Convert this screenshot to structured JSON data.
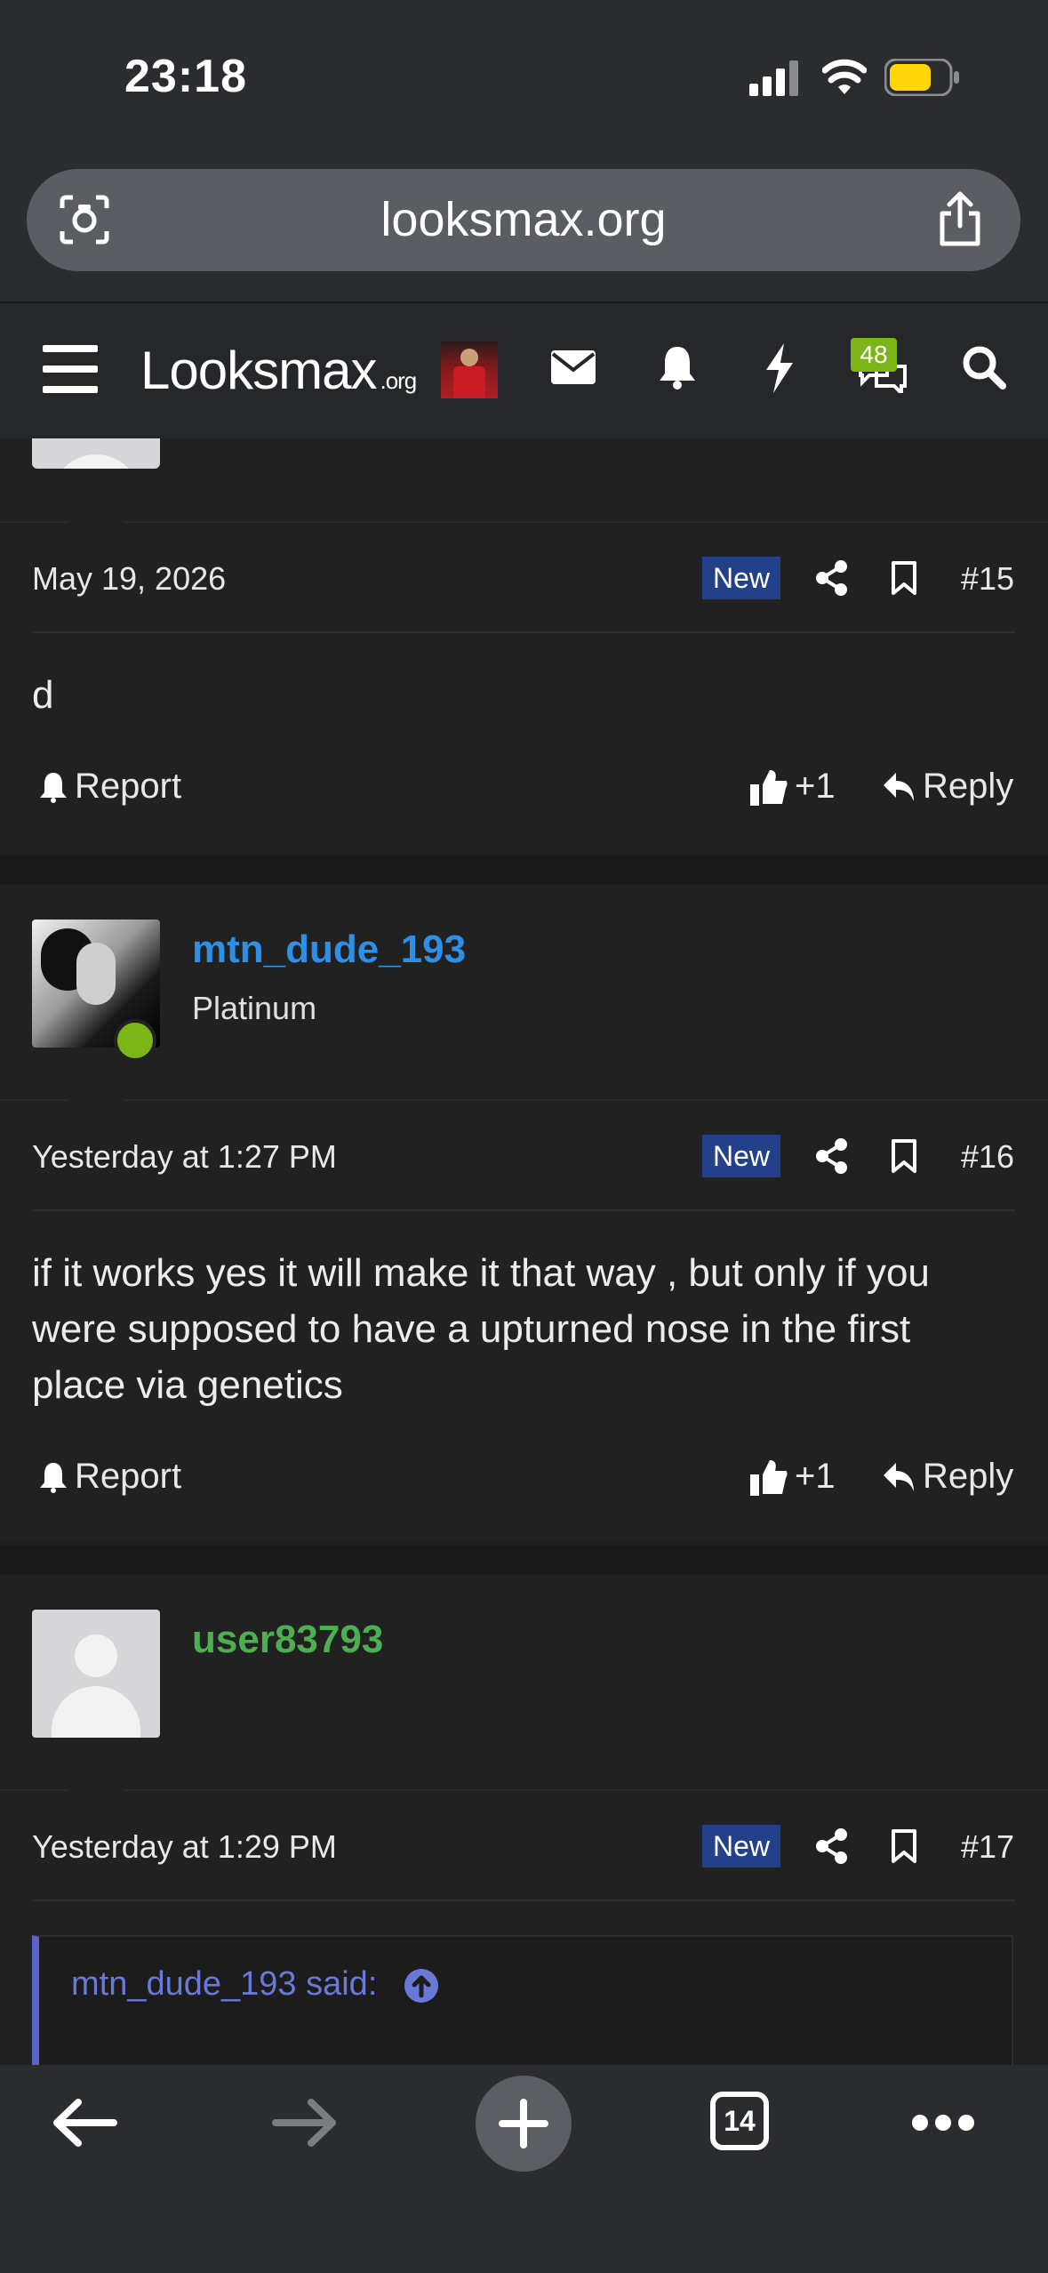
{
  "status_bar": {
    "time": "23:18"
  },
  "browser": {
    "url": "looksmax.org",
    "tab_count": "14"
  },
  "site_nav": {
    "logo_main": "Looksmax",
    "logo_suffix": ".org",
    "chat_badge": "48"
  },
  "posts": [
    {
      "date": "May 19, 2026",
      "badge": "New",
      "number": "#15",
      "body": "d",
      "report_label": "Report",
      "reaction": "+1",
      "reply_label": "Reply"
    },
    {
      "username": "mtn_dude_193",
      "user_title": "Platinum",
      "date": "Yesterday at 1:27 PM",
      "badge": "New",
      "number": "#16",
      "body": "if it works yes it will make it that way , but only if you were supposed to have a upturned nose in the first place via genetics",
      "report_label": "Report",
      "reaction": "+1",
      "reply_label": "Reply"
    },
    {
      "username": "user83793",
      "date": "Yesterday at 1:29 PM",
      "badge": "New",
      "number": "#17",
      "quote_author": "mtn_dude_193 said:"
    }
  ],
  "colors": {
    "username_blue": "#2d8fe6",
    "username_green": "#4caf50",
    "badge_blue": "#23408a",
    "online_green": "#7cb518"
  }
}
